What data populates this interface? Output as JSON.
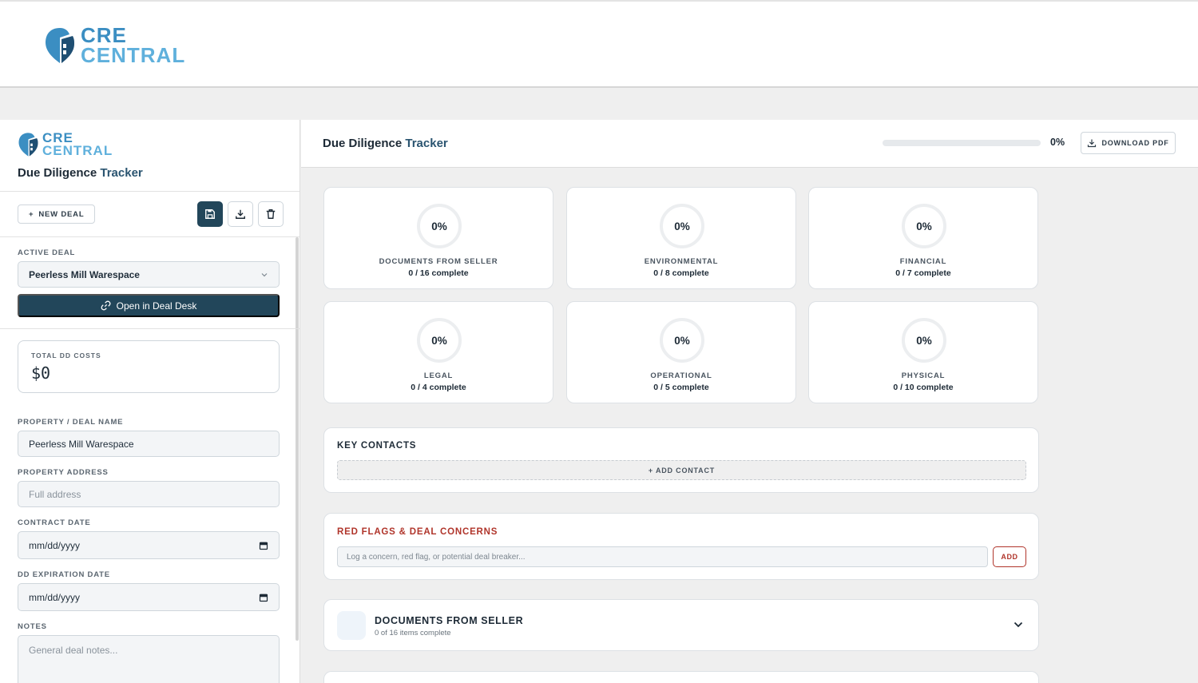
{
  "brand": {
    "line1": "CRE",
    "line2": "CENTRAL"
  },
  "sidebar": {
    "title_main": "Due Diligence",
    "title_accent": "Tracker",
    "new_deal_label": "NEW DEAL",
    "save_icon": "save-icon",
    "download_icon": "download-icon",
    "delete_icon": "trash-icon",
    "active_deal_label": "ACTIVE DEAL",
    "active_deal_value": "Peerless Mill Warespace",
    "open_deal_desk_label": "Open in Deal Desk",
    "total_costs_label": "TOTAL DD COSTS",
    "total_costs_value": "$0",
    "property_name_label": "PROPERTY / DEAL NAME",
    "property_name_value": "Peerless Mill Warespace",
    "property_address_label": "PROPERTY ADDRESS",
    "property_address_placeholder": "Full address",
    "contract_date_label": "CONTRACT DATE",
    "contract_date_placeholder": "mm/dd/yyyy",
    "dd_expiration_label": "DD EXPIRATION DATE",
    "dd_expiration_placeholder": "mm/dd/yyyy",
    "notes_label": "NOTES",
    "notes_placeholder": "General deal notes..."
  },
  "header": {
    "title_main": "Due Diligence",
    "title_accent": "Tracker",
    "overall_progress": 0,
    "overall_progress_text": "0%",
    "download_pdf_label": "DOWNLOAD PDF"
  },
  "categories": [
    {
      "name": "DOCUMENTS FROM SELLER",
      "pct": "0%",
      "count": "0 / 16 complete"
    },
    {
      "name": "ENVIRONMENTAL",
      "pct": "0%",
      "count": "0 / 8 complete"
    },
    {
      "name": "FINANCIAL",
      "pct": "0%",
      "count": "0 / 7 complete"
    },
    {
      "name": "LEGAL",
      "pct": "0%",
      "count": "0 / 4 complete"
    },
    {
      "name": "OPERATIONAL",
      "pct": "0%",
      "count": "0 / 5 complete"
    },
    {
      "name": "PHYSICAL",
      "pct": "0%",
      "count": "0 / 10 complete"
    }
  ],
  "contacts": {
    "title": "KEY CONTACTS",
    "add_label": "+ ADD CONTACT"
  },
  "red_flags": {
    "title": "RED FLAGS & DEAL CONCERNS",
    "placeholder": "Log a concern, red flag, or potential deal breaker...",
    "add_label": "ADD"
  },
  "sections": [
    {
      "title": "DOCUMENTS FROM SELLER",
      "subtitle": "0 of 16 items complete"
    }
  ],
  "colors": {
    "primary": "#22465a",
    "accent_red": "#b0352b",
    "brand_blue": "#3b8ec2"
  }
}
